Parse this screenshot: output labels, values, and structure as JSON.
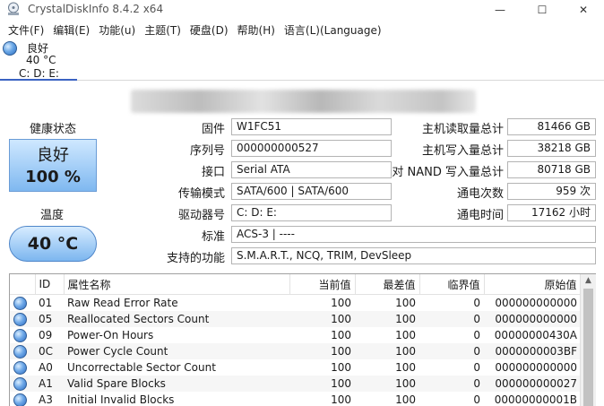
{
  "app": {
    "title": "CrystalDiskInfo 8.4.2 x64",
    "window_buttons": {
      "minimize": "—",
      "maximize": "☐",
      "close": "✕"
    }
  },
  "menu": [
    "文件(F)",
    "编辑(E)",
    "功能(u)",
    "主题(T)",
    "硬盘(D)",
    "帮助(H)",
    "语言(L)(Language)"
  ],
  "drive_tab": {
    "status": "良好",
    "temp": "40 °C",
    "drives": "C: D: E:"
  },
  "health": {
    "label": "健康状态",
    "status": "良好",
    "percent": "100 %"
  },
  "temperature": {
    "label": "温度",
    "value": "40 °C"
  },
  "info": {
    "firmware": {
      "label": "固件",
      "value": "W1FC51"
    },
    "serial": {
      "label": "序列号",
      "value": "000000000527"
    },
    "interface": {
      "label": "接口",
      "value": "Serial ATA"
    },
    "transfer_mode": {
      "label": "传输模式",
      "value": "SATA/600 | SATA/600"
    },
    "drive_letter": {
      "label": "驱动器号",
      "value": "C: D: E:"
    },
    "standard": {
      "label": "标准",
      "value": "ACS-3 | ----"
    },
    "features": {
      "label": "支持的功能",
      "value": "S.M.A.R.T., NCQ, TRIM, DevSleep"
    },
    "host_reads": {
      "label": "主机读取量总计",
      "value": "81466 GB"
    },
    "host_writes": {
      "label": "主机写入量总计",
      "value": "38218 GB"
    },
    "nand_writes": {
      "label": "对 NAND 写入量总计",
      "value": "80718 GB"
    },
    "power_on_count": {
      "label": "通电次数",
      "value": "959 次"
    },
    "power_on_hours": {
      "label": "通电时间",
      "value": "17162 小时"
    }
  },
  "smart_table": {
    "headers": [
      "ID",
      "属性名称",
      "当前值",
      "最差值",
      "临界值",
      "原始值"
    ],
    "rows": [
      {
        "id": "01",
        "name": "Raw Read Error Rate",
        "current": "100",
        "worst": "100",
        "threshold": "0",
        "raw": "000000000000"
      },
      {
        "id": "05",
        "name": "Reallocated Sectors Count",
        "current": "100",
        "worst": "100",
        "threshold": "0",
        "raw": "000000000000"
      },
      {
        "id": "09",
        "name": "Power-On Hours",
        "current": "100",
        "worst": "100",
        "threshold": "0",
        "raw": "00000000430A"
      },
      {
        "id": "0C",
        "name": "Power Cycle Count",
        "current": "100",
        "worst": "100",
        "threshold": "0",
        "raw": "0000000003BF"
      },
      {
        "id": "A0",
        "name": "Uncorrectable Sector Count",
        "current": "100",
        "worst": "100",
        "threshold": "0",
        "raw": "000000000000"
      },
      {
        "id": "A1",
        "name": "Valid Spare Blocks",
        "current": "100",
        "worst": "100",
        "threshold": "0",
        "raw": "000000000027"
      },
      {
        "id": "A3",
        "name": "Initial Invalid Blocks",
        "current": "100",
        "worst": "100",
        "threshold": "0",
        "raw": "00000000001B"
      }
    ]
  },
  "colors": {
    "accent": "#3a62c2",
    "health_good": "#7fb8f0"
  }
}
